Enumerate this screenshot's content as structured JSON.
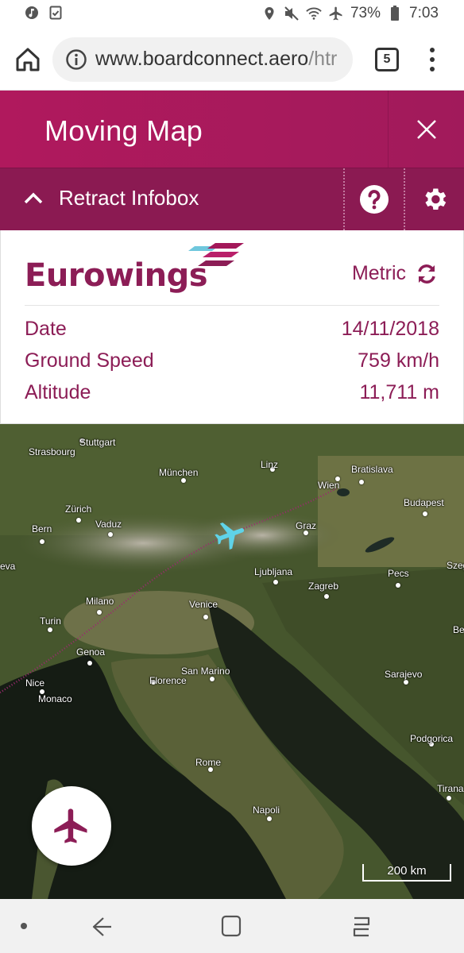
{
  "status_bar": {
    "battery": "73%",
    "time": "7:03"
  },
  "browser": {
    "url_main": "www.boardconnect.aero",
    "url_tail": "/htr",
    "tab_count": "5"
  },
  "app": {
    "title": "Moving Map",
    "retract_label": "Retract Infobox"
  },
  "infobox": {
    "brand": "Eurowings",
    "units_label": "Metric",
    "rows": [
      {
        "label": "Date",
        "value": "14/11/2018"
      },
      {
        "label": "Ground Speed",
        "value": "759 km/h"
      },
      {
        "label": "Altitude",
        "value": "11,711 m"
      }
    ]
  },
  "map": {
    "cities": [
      "Stuttgart",
      "Strasbourg",
      "München",
      "Linz",
      "Bratislava",
      "Wien",
      "Zürich",
      "Vaduz",
      "Budapest",
      "Bern",
      "Graz",
      "eva",
      "Ljubljana",
      "Pecs",
      "Szeg",
      "Zagreb",
      "Milano",
      "Venice",
      "Turin",
      "Be",
      "Genoa",
      "San Marino",
      "Sarajevo",
      "Florence",
      "Nice",
      "Monaco",
      "Podgorica",
      "Rome",
      "Tirana",
      "Napoli"
    ],
    "scale_label": "200 km"
  },
  "colors": {
    "brand": "#8c1d56",
    "header": "#a11a5b",
    "subheader": "#8b1a52",
    "plane_marker": "#5fd3e8"
  }
}
